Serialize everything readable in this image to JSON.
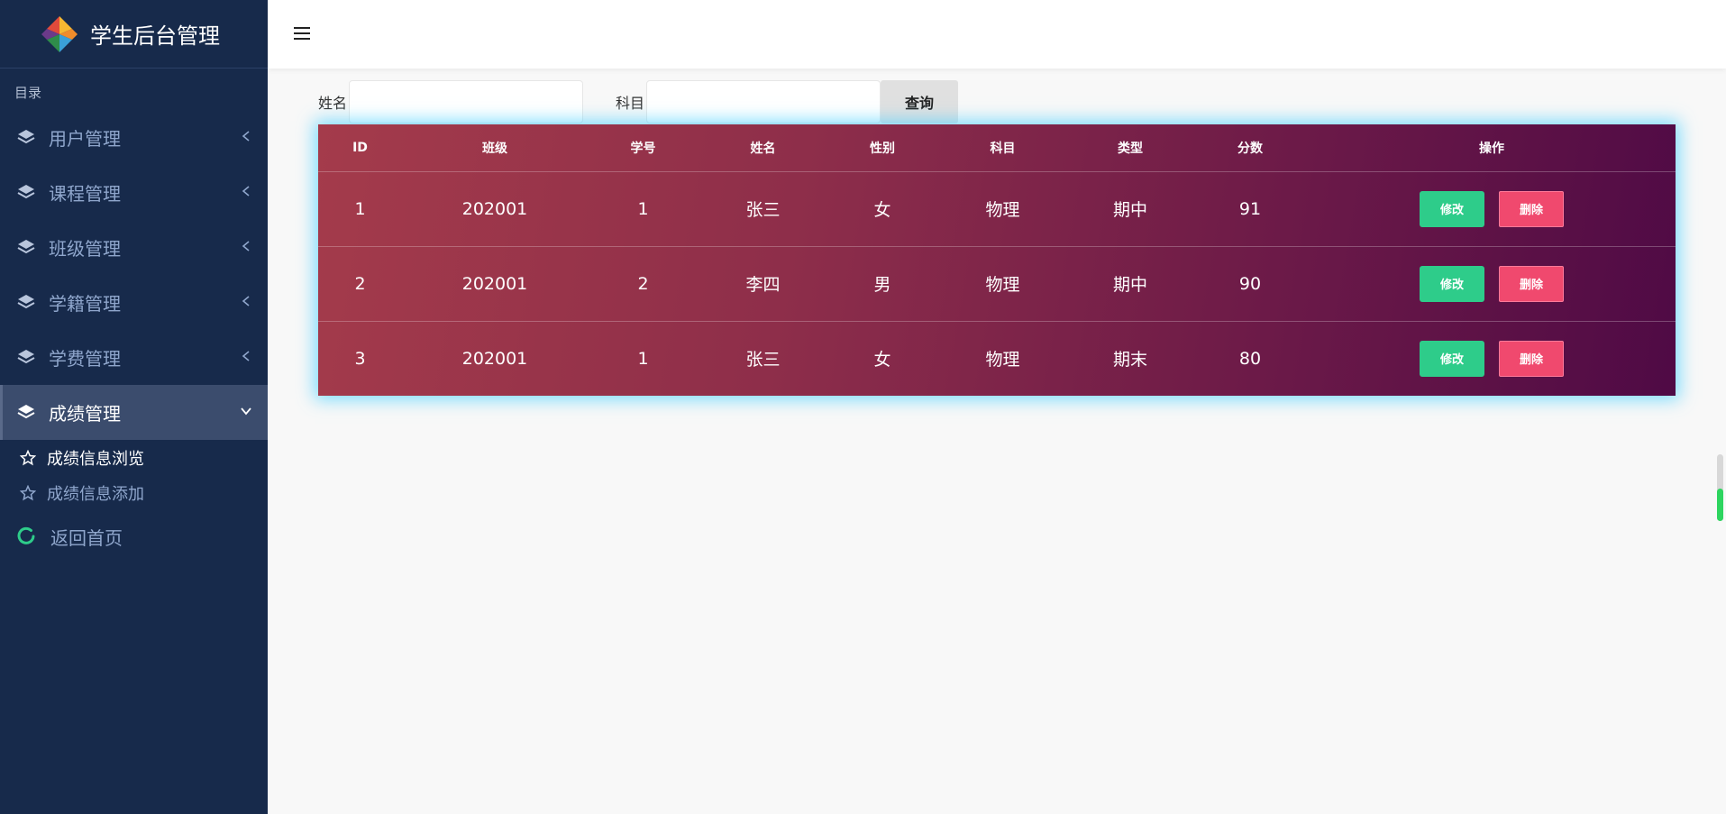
{
  "brand": {
    "title": "学生后台管理"
  },
  "sidebar": {
    "section_label": "目录",
    "menu": [
      {
        "label": "用户管理"
      },
      {
        "label": "课程管理"
      },
      {
        "label": "班级管理"
      },
      {
        "label": "学籍管理"
      },
      {
        "label": "学费管理"
      },
      {
        "label": "成绩管理"
      }
    ],
    "submenu": [
      {
        "label": "成绩信息浏览"
      },
      {
        "label": "成绩信息添加"
      }
    ],
    "home_label": "返回首页"
  },
  "search": {
    "name_label": "姓名",
    "name_value": "",
    "subject_label": "科目",
    "subject_value": "",
    "query_label": "查询"
  },
  "table": {
    "headers": [
      "ID",
      "班级",
      "学号",
      "姓名",
      "性别",
      "科目",
      "类型",
      "分数",
      "操作"
    ],
    "rows": [
      {
        "id": "1",
        "class": "202001",
        "student_no": "1",
        "name": "张三",
        "gender": "女",
        "subject": "物理",
        "type": "期中",
        "score": "91"
      },
      {
        "id": "2",
        "class": "202001",
        "student_no": "2",
        "name": "李四",
        "gender": "男",
        "subject": "物理",
        "type": "期中",
        "score": "90"
      },
      {
        "id": "3",
        "class": "202001",
        "student_no": "1",
        "name": "张三",
        "gender": "女",
        "subject": "物理",
        "type": "期末",
        "score": "80"
      }
    ],
    "edit_label": "修改",
    "delete_label": "删除"
  },
  "colors": {
    "sidebar_bg": "#172a4b",
    "edit_button": "#2ecc8a",
    "delete_button": "#f0496e",
    "table_glow": "#50d2ff"
  }
}
